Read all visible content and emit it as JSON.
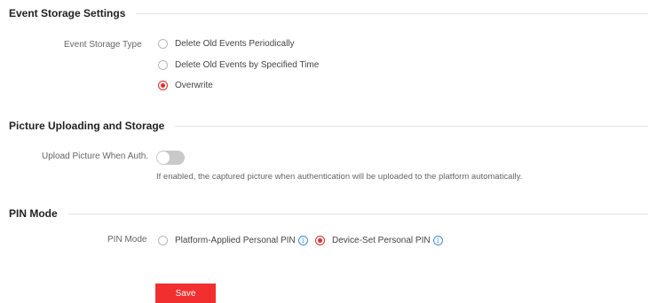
{
  "event_storage": {
    "title": "Event Storage Settings",
    "type_label": "Event Storage Type",
    "options": [
      {
        "label": "Delete Old Events Periodically",
        "selected": false
      },
      {
        "label": "Delete Old Events by Specified Time",
        "selected": false
      },
      {
        "label": "Overwrite",
        "selected": true
      }
    ]
  },
  "picture_upload": {
    "title": "Picture Uploading and Storage",
    "upload_label": "Upload Picture When Auth.",
    "upload_enabled": false,
    "hint": "If enabled, the captured picture when authentication will be uploaded to the platform automatically."
  },
  "pin_mode": {
    "title": "PIN Mode",
    "label": "PIN Mode",
    "options": [
      {
        "label": "Platform-Applied Personal PIN",
        "selected": false,
        "info_icon": "info-icon"
      },
      {
        "label": "Device-Set Personal PIN",
        "selected": true,
        "info_icon": "info-icon"
      }
    ]
  },
  "actions": {
    "save_label": "Save"
  },
  "colors": {
    "accent": "#f22f2f",
    "info": "#3a8ee6",
    "toggle_off": "#c9c9c9"
  }
}
